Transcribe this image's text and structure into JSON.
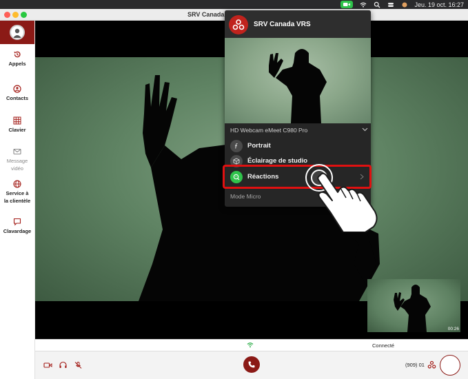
{
  "menubar": {
    "datetime": "Jeu. 19 oct. 16:27",
    "icons": [
      "camera-active-icon",
      "wifi-icon",
      "search-icon",
      "control-center-icon",
      "siri-icon"
    ]
  },
  "window": {
    "title": "SRV Canada VRS"
  },
  "sidebar": {
    "items": [
      {
        "label": "Appels",
        "icon": "history-icon"
      },
      {
        "label": "Contacts",
        "icon": "contacts-icon"
      },
      {
        "label": "Clavier",
        "icon": "keypad-icon"
      },
      {
        "label_line1": "Message",
        "label_line2": "vidéo",
        "icon": "mail-icon"
      },
      {
        "label_line1": "Service à",
        "label_line2": "la clientèle",
        "icon": "globe-icon"
      },
      {
        "label": "Clavardage",
        "icon": "chat-icon"
      }
    ]
  },
  "call": {
    "timer": "00:26",
    "status": "Connecté",
    "phone_number": "(909) 01"
  },
  "popup": {
    "title": "SRV Canada VRS",
    "camera_name": "HD Webcam eMeet C980 Pro",
    "items": [
      {
        "label": "Portrait",
        "icon": "portrait-f-icon",
        "active": false
      },
      {
        "label": "Éclairage de studio",
        "icon": "cube-icon",
        "active": false
      },
      {
        "label": "Réactions",
        "icon": "reactions-icon",
        "active": true
      }
    ],
    "section": "Mode Micro"
  },
  "colors": {
    "brand": "#8b1a16",
    "brand_bright": "#c0231d",
    "highlight": "#e01010",
    "active_green": "#2fc34b"
  }
}
